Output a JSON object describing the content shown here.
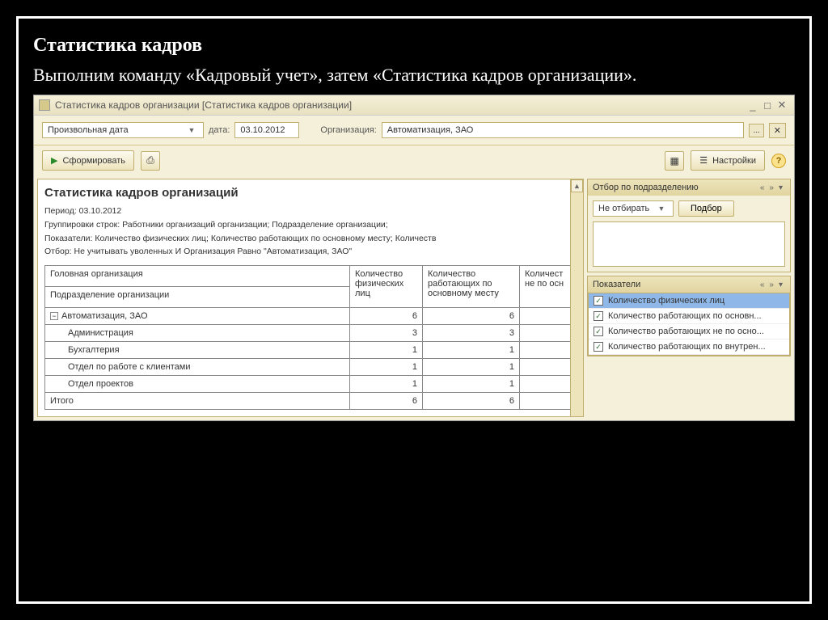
{
  "slide": {
    "title": "Статистика кадров",
    "subtitle": "Выполним команду «Кадровый учет», затем «Статистика кадров организации»."
  },
  "window": {
    "title": "Статистика кадров организации [Статистика кадров организации]"
  },
  "filter": {
    "period_mode": "Произвольная дата",
    "date_label": "дата:",
    "date_value": "03.10.2012",
    "org_label": "Организация:",
    "org_value": "Автоматизация, ЗАО"
  },
  "toolbar": {
    "run_label": "Сформировать",
    "settings_label": "Настройки"
  },
  "report": {
    "title": "Статистика кадров организаций",
    "period_label": "Период:",
    "period_value": "03.10.2012",
    "grouping": "Группировки строк: Работники организаций организации; Подразделение организации;",
    "indicators": "Показатели: Количество физических лиц; Количество работающих по основному месту; Количеств",
    "filter": "Отбор: Не учитывать уволенных И Организация Равно \"Автоматизация, ЗАО\"",
    "cols": {
      "c1a": "Головная организация",
      "c1b": "Подразделение организации",
      "c2": "Количество физических лиц",
      "c3": "Количество работающих по основному месту",
      "c4": "Количест не по осн"
    },
    "rows": [
      {
        "label": "Автоматизация, ЗАО",
        "v1": "6",
        "v2": "6",
        "group": true
      },
      {
        "label": "Администрация",
        "v1": "3",
        "v2": "3"
      },
      {
        "label": "Бухгалтерия",
        "v1": "1",
        "v2": "1"
      },
      {
        "label": "Отдел по работе с клиентами",
        "v1": "1",
        "v2": "1"
      },
      {
        "label": "Отдел проектов",
        "v1": "1",
        "v2": "1"
      }
    ],
    "total_label": "Итого",
    "total_v1": "6",
    "total_v2": "6"
  },
  "side": {
    "panel1_title": "Отбор по подразделению",
    "no_filter": "Не отбирать",
    "select_btn": "Подбор",
    "panel2_title": "Показатели",
    "indicators": [
      "Количество физических лиц",
      "Количество работающих по основн...",
      "Количество работающих не по осно...",
      "Количество работающих по внутрен..."
    ]
  }
}
